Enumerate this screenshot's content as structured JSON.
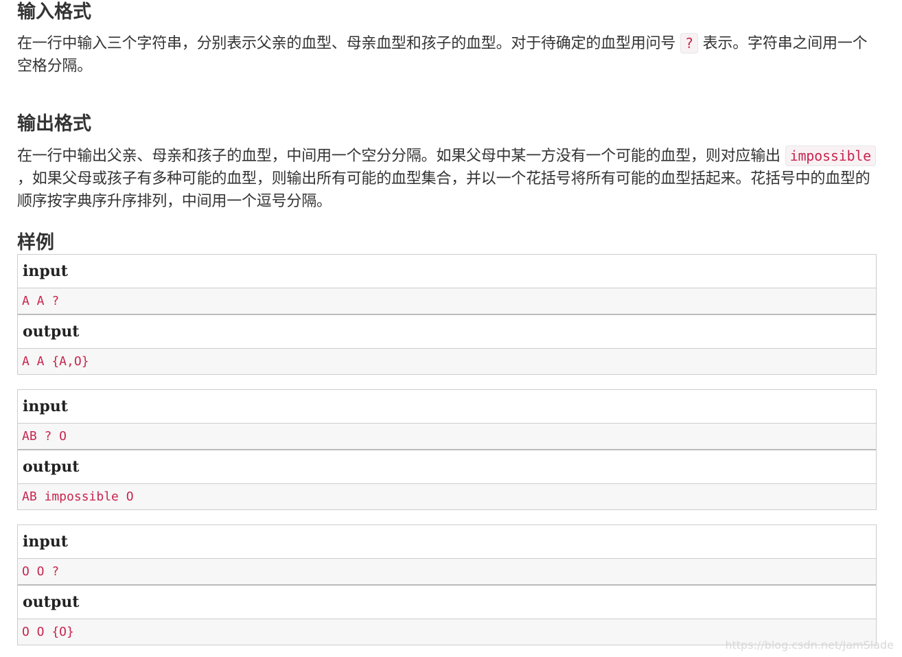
{
  "input_format": {
    "heading": "输入格式",
    "text_before": "在一行中输入三个字符串，分别表示父亲的血型、母亲血型和孩子的血型。对于待确定的血型用问号 ",
    "code": "?",
    "text_after": " 表示。字符串之间用一个空格分隔。"
  },
  "output_format": {
    "heading": "输出格式",
    "text_before": "在一行中输出父亲、母亲和孩子的血型，中间用一个空分分隔。如果父母中某一方没有一个可能的血型，则对应输出 ",
    "code": "impossible",
    "text_after": " ，如果父母或孩子有多种可能的血型，则输出所有可能的血型集合，并以一个花括号将所有可能的血型括起来。花括号中的血型的顺序按字典序升序排列，中间用一个逗号分隔。"
  },
  "samples": {
    "heading": "样例",
    "items": [
      {
        "input_label": "input",
        "input": "A A ?",
        "output_label": "output",
        "output": "A A {A,O}"
      },
      {
        "input_label": "input",
        "input": "AB ? O",
        "output_label": "output",
        "output": "AB impossible O"
      },
      {
        "input_label": "input",
        "input": "O O ?",
        "output_label": "output",
        "output": "O O {O}"
      }
    ]
  },
  "watermark": "https://blog.csdn.net/JamSlade"
}
